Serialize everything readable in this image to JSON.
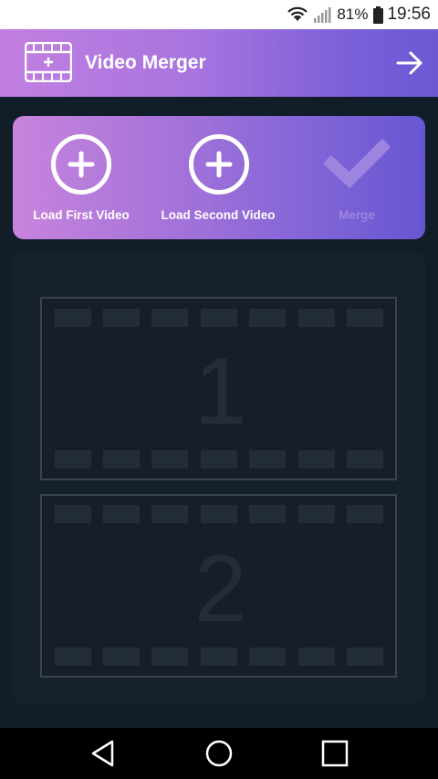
{
  "status_bar": {
    "battery_percent": "81%",
    "time": "19:56",
    "icons": [
      "wifi-icon",
      "signal-icon",
      "battery-icon"
    ]
  },
  "header": {
    "title": "Video Merger",
    "logo_icon": "film-add-icon",
    "next_icon": "arrow-right-icon"
  },
  "actions": {
    "load_first": {
      "label": "Load First Video",
      "icon": "plus-circle-icon"
    },
    "load_second": {
      "label": "Load Second Video",
      "icon": "plus-circle-icon"
    },
    "merge": {
      "label": "Merge",
      "icon": "checkmark-icon",
      "enabled": false
    }
  },
  "slots": {
    "first": {
      "number": "1"
    },
    "second": {
      "number": "2"
    }
  },
  "navigation": {
    "back_icon": "back-triangle-icon",
    "home_icon": "home-circle-icon",
    "recent_icon": "recent-square-icon"
  },
  "colors": {
    "header_gradient_start": "#c27fe0",
    "header_gradient_end": "#6b59d4",
    "background": "#111d29",
    "panel": "#17212d",
    "disabled_text": "#9c84e0"
  }
}
